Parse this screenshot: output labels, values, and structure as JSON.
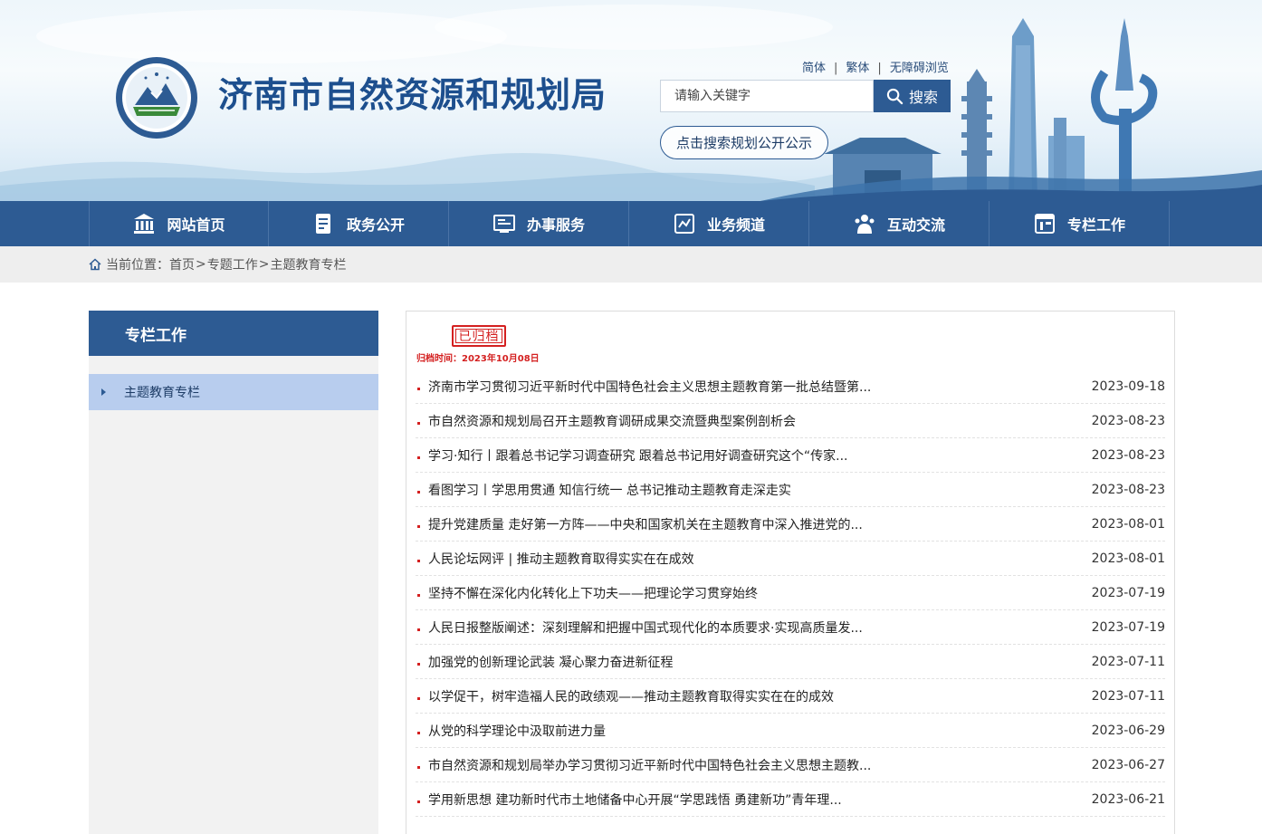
{
  "header": {
    "site_title": "济南市自然资源和规划局",
    "logo_icon": "bureau-emblem-icon",
    "lang_links": [
      "简体",
      "繁体",
      "无障碍浏览"
    ],
    "search": {
      "placeholder": "请输入关键字",
      "button_label": "搜索",
      "button_icon": "search-icon"
    },
    "plan_button_label": "点击搜索规划公开公示",
    "colors": {
      "brand": "#2d5b93",
      "title": "#1d4f8e"
    }
  },
  "nav": {
    "items": [
      {
        "label": "网站首页",
        "icon": "home-building-icon"
      },
      {
        "label": "政务公开",
        "icon": "document-icon"
      },
      {
        "label": "办事服务",
        "icon": "service-desk-icon"
      },
      {
        "label": "业务频道",
        "icon": "channel-icon"
      },
      {
        "label": "互动交流",
        "icon": "people-icon"
      },
      {
        "label": "专栏工作",
        "icon": "column-icon"
      }
    ]
  },
  "breadcrumb": {
    "prefix": "当前位置：",
    "items": [
      "首页",
      "专题工作",
      "主题教育专栏"
    ],
    "separator": ">"
  },
  "sidebar": {
    "title": "专栏工作",
    "items": [
      {
        "label": "主题教育专栏",
        "active": true
      }
    ]
  },
  "main": {
    "stamp_label": "已归档",
    "archive_time": "归档时间：2023年10月08日",
    "news": [
      {
        "title": "济南市学习贯彻习近平新时代中国特色社会主义思想主题教育第一批总结暨第...",
        "date": "2023-09-18"
      },
      {
        "title": "市自然资源和规划局召开主题教育调研成果交流暨典型案例剖析会",
        "date": "2023-08-23"
      },
      {
        "title": "学习·知行丨跟着总书记学习调查研究 跟着总书记用好调查研究这个“传家...",
        "date": "2023-08-23"
      },
      {
        "title": "看图学习丨学思用贯通 知信行统一 总书记推动主题教育走深走实",
        "date": "2023-08-23"
      },
      {
        "title": "提升党建质量 走好第一方阵——中央和国家机关在主题教育中深入推进党的...",
        "date": "2023-08-01"
      },
      {
        "title": "人民论坛网评 | 推动主题教育取得实实在在成效",
        "date": "2023-08-01"
      },
      {
        "title": "坚持不懈在深化内化转化上下功夫——把理论学习贯穿始终",
        "date": "2023-07-19"
      },
      {
        "title": "人民日报整版阐述：深刻理解和把握中国式现代化的本质要求·实现高质量发...",
        "date": "2023-07-19"
      },
      {
        "title": "加强党的创新理论武装 凝心聚力奋进新征程",
        "date": "2023-07-11"
      },
      {
        "title": "以学促干，树牢造福人民的政绩观——推动主题教育取得实实在在的成效",
        "date": "2023-07-11"
      },
      {
        "title": "从党的科学理论中汲取前进力量",
        "date": "2023-06-29"
      },
      {
        "title": "市自然资源和规划局举办学习贯彻习近平新时代中国特色社会主义思想主题教...",
        "date": "2023-06-27"
      },
      {
        "title": "学用新思想 建功新时代市土地储备中心开展“学思践悟 勇建新功”青年理...",
        "date": "2023-06-21"
      }
    ]
  }
}
